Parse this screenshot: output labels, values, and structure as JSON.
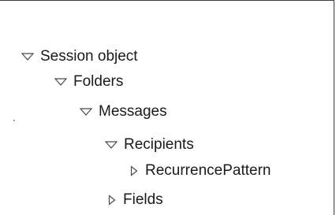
{
  "tree": {
    "session": {
      "label": "Session object",
      "state": "expanded"
    },
    "folders": {
      "label": "Folders",
      "state": "expanded"
    },
    "messages": {
      "label": "Messages",
      "state": "expanded"
    },
    "recipients": {
      "label": "Recipients",
      "state": "expanded"
    },
    "recurrence": {
      "label": "RecurrencePattern",
      "state": "collapsed"
    },
    "fields": {
      "label": "Fields",
      "state": "collapsed"
    }
  },
  "colors": {
    "text": "#1a1a1a",
    "triangle_stroke": "#4a4a4a",
    "frame": "#3a3a3a"
  },
  "icons": {
    "expanded": "triangle-down-icon",
    "collapsed": "triangle-right-icon"
  }
}
